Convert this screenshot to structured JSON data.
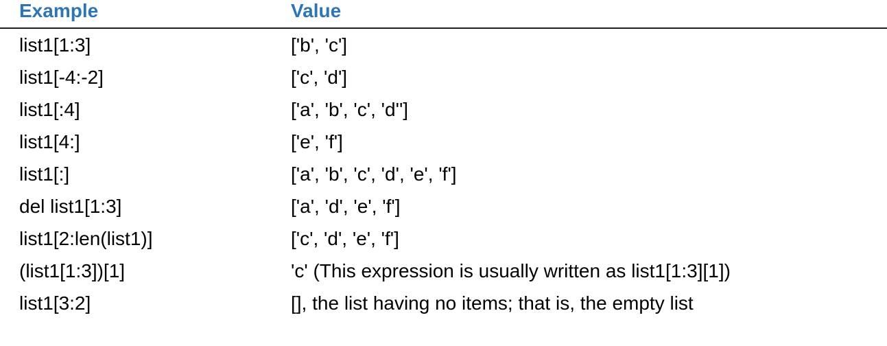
{
  "table": {
    "headers": [
      "Example",
      "Value"
    ],
    "rows": [
      {
        "example": "list1[1:3]",
        "value": "['b', 'c']"
      },
      {
        "example": "list1[-4:-2]",
        "value": "['c', 'd']"
      },
      {
        "example": "list1[:4]",
        "value": "['a', 'b', 'c', 'd'']"
      },
      {
        "example": "list1[4:]",
        "value": "['e', 'f']"
      },
      {
        "example": "list1[:]",
        "value": "['a', 'b', 'c', 'd', 'e', 'f']"
      },
      {
        "example": "del list1[1:3]",
        "value": "['a', 'd', 'e', 'f']"
      },
      {
        "example": "list1[2:len(list1)]",
        "value": "['c', 'd', 'e', 'f']"
      },
      {
        "example": "(list1[1:3])[1]",
        "value": "'c' (This expression is usually written as list1[1:3][1])"
      },
      {
        "example": "list1[3:2]",
        "value": "[], the list having no items; that is, the empty list"
      }
    ]
  },
  "colors": {
    "header_text": "#2e75b6",
    "rule": "#1f1f1f",
    "body_text": "#000000"
  }
}
